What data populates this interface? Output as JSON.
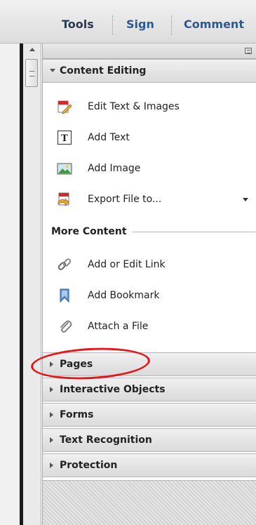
{
  "toolbar": {
    "tools_label": "Tools",
    "sign_label": "Sign",
    "comment_label": "Comment"
  },
  "panel": {
    "content_editing": {
      "header": "Content Editing",
      "items": [
        {
          "label": "Edit Text & Images",
          "icon": "edit-text-images-icon"
        },
        {
          "label": "Add Text",
          "icon": "add-text-icon"
        },
        {
          "label": "Add Image",
          "icon": "add-image-icon"
        },
        {
          "label": "Export File to...",
          "icon": "export-file-icon"
        }
      ]
    },
    "more_content": {
      "header": "More Content",
      "items": [
        {
          "label": "Add or Edit Link",
          "icon": "link-icon"
        },
        {
          "label": "Add Bookmark",
          "icon": "bookmark-icon"
        },
        {
          "label": "Attach a File",
          "icon": "paperclip-icon"
        }
      ]
    },
    "sections": [
      {
        "label": "Pages"
      },
      {
        "label": "Interactive Objects"
      },
      {
        "label": "Forms"
      },
      {
        "label": "Text Recognition"
      },
      {
        "label": "Protection"
      }
    ]
  },
  "colors": {
    "annotation": "#e8141a",
    "toolbar_text": "#2b3b4e",
    "link_blue": "#2a5a8f"
  }
}
